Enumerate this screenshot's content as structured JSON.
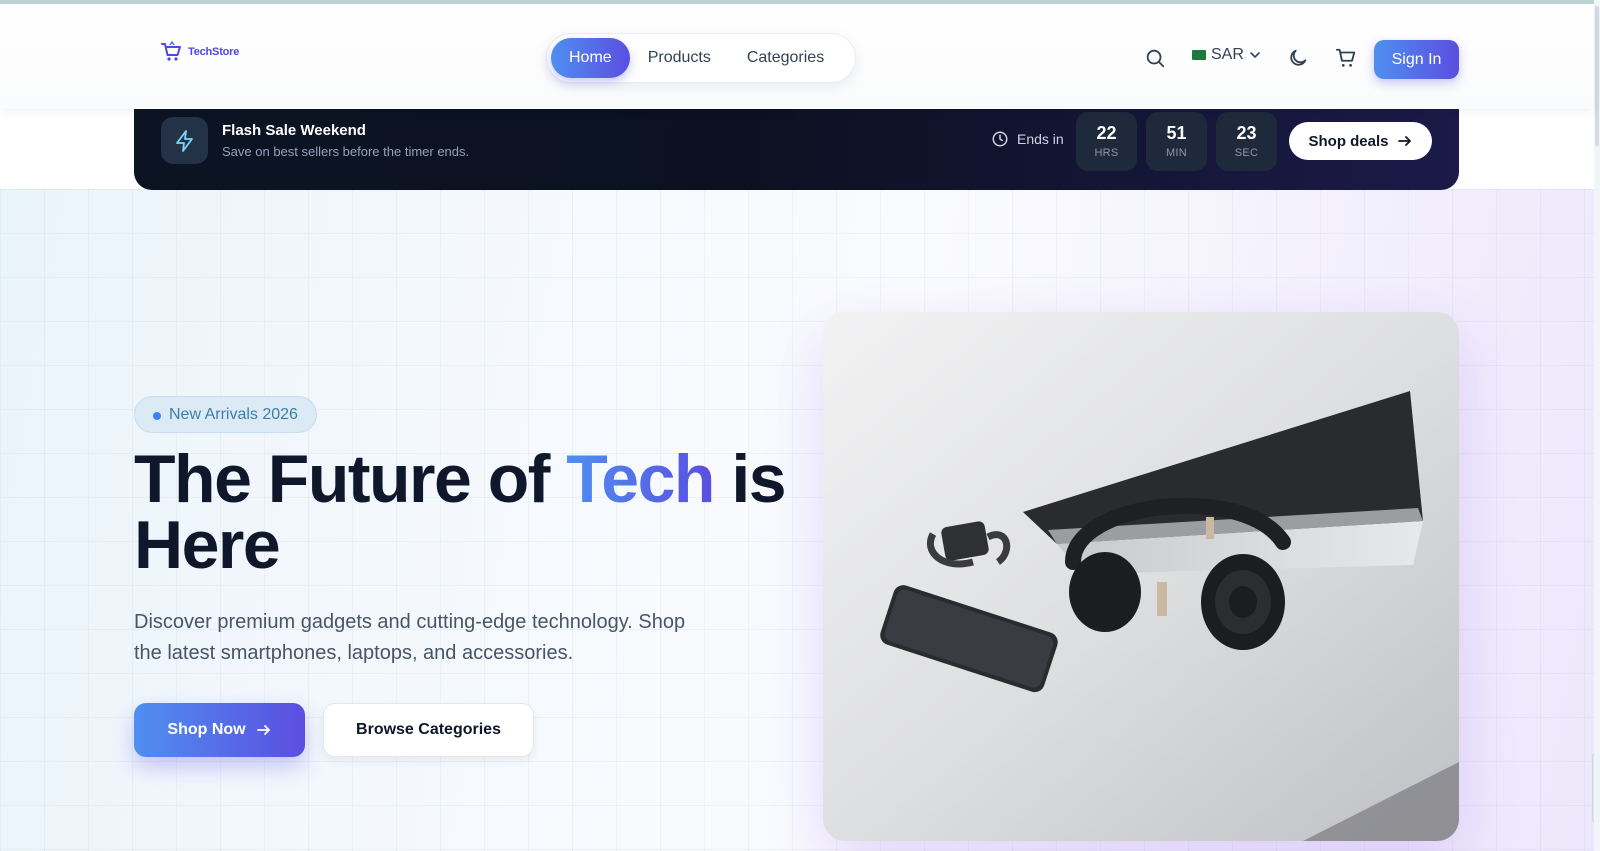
{
  "header": {
    "logo_text": "TechStore",
    "nav": [
      {
        "label": "Home",
        "active": true
      },
      {
        "label": "Products",
        "active": false
      },
      {
        "label": "Categories",
        "active": false
      }
    ],
    "currency": "SAR",
    "sign_in": "Sign In",
    "icons": [
      "search-icon",
      "chevron-down-icon",
      "moon-icon",
      "cart-icon"
    ]
  },
  "flash_sale": {
    "title": "Flash Sale Weekend",
    "subtitle": "Save on best sellers before the timer ends.",
    "ends_in_label": "Ends in",
    "timer": [
      {
        "value": "22",
        "unit": "HRS"
      },
      {
        "value": "51",
        "unit": "MIN"
      },
      {
        "value": "23",
        "unit": "SEC"
      }
    ],
    "cta": "Shop deals"
  },
  "hero": {
    "badge": "New Arrivals 2026",
    "headline_part1": "The Future of ",
    "headline_highlight": "Tech",
    "headline_part2": " is Here",
    "description": "Discover premium gadgets and cutting-edge technology. Shop the latest smartphones, laptops, and accessories.",
    "primary_cta": "Shop Now",
    "secondary_cta": "Browse Categories"
  },
  "colors": {
    "accent_start": "#4f8ff0",
    "accent_end": "#5b4ee0",
    "flash_bg": "#0b1120",
    "text_dark": "#0f172a"
  }
}
